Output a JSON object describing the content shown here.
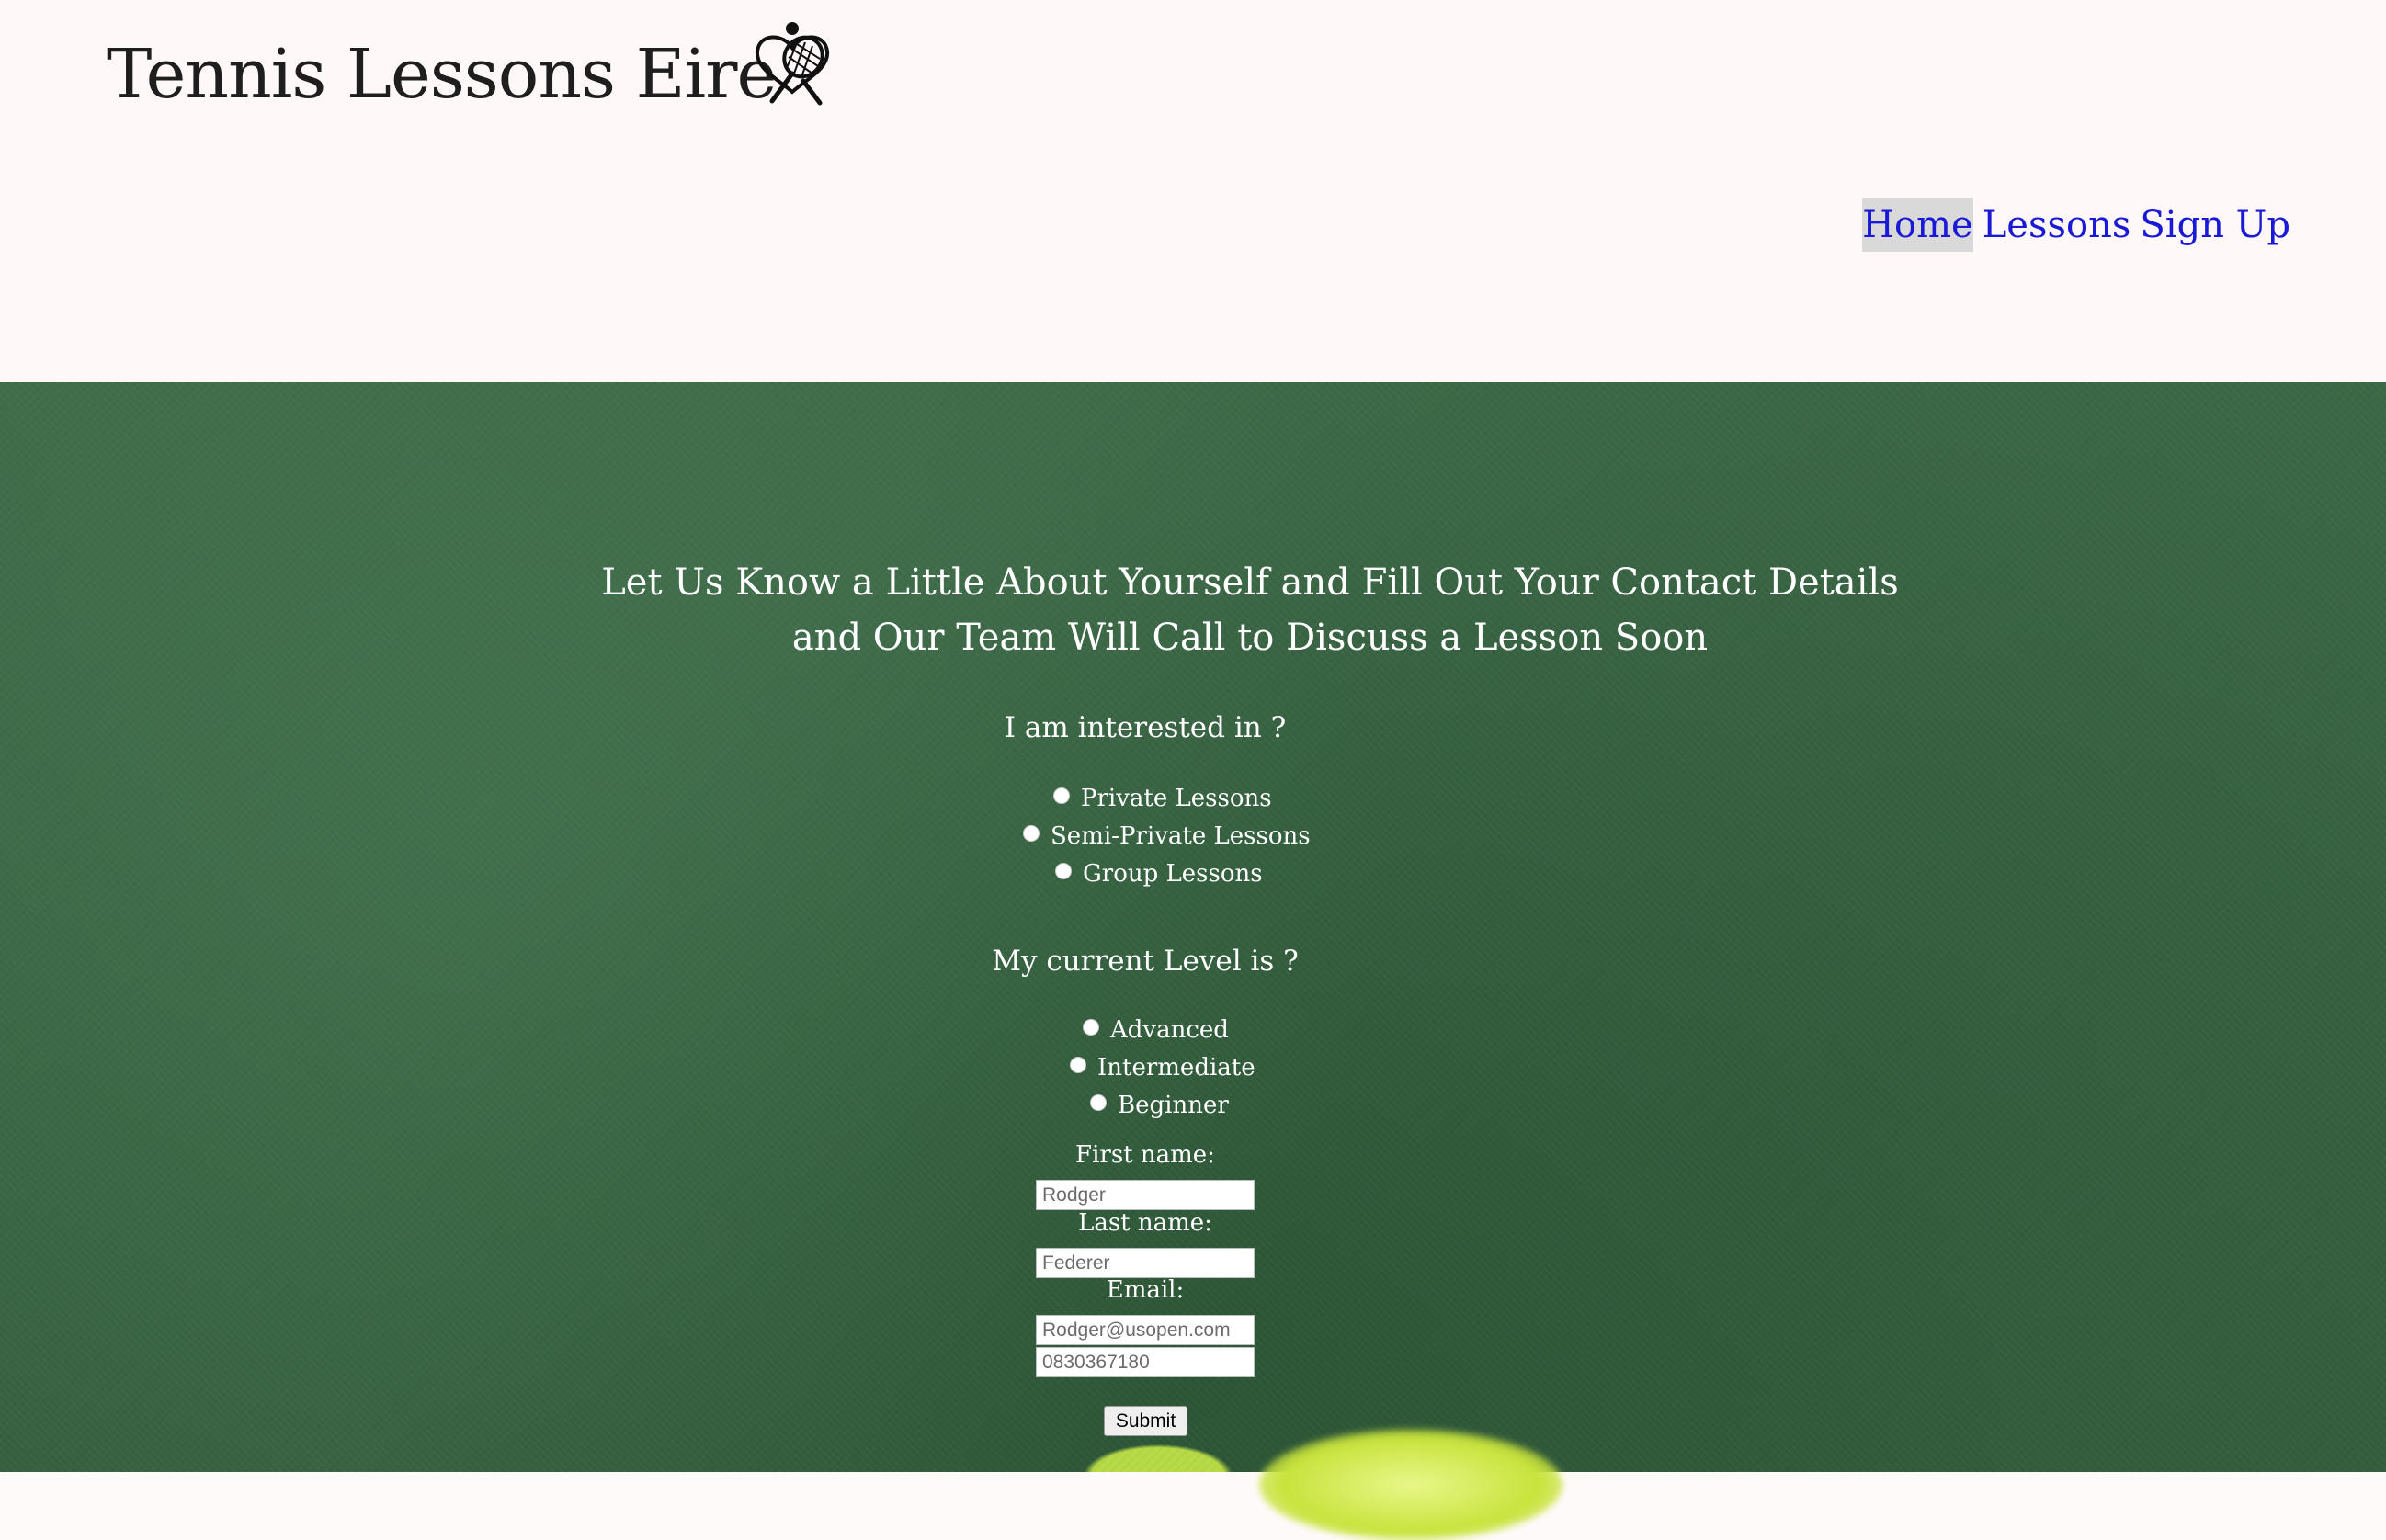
{
  "header": {
    "logo_text": "Tennis Lessons Eire",
    "logo_icon": "tennis-racket-heart-icon"
  },
  "nav": {
    "items": [
      {
        "label": "Home",
        "active": true
      },
      {
        "label": "Lessons",
        "active": false
      },
      {
        "label": "Sign Up",
        "active": false
      }
    ]
  },
  "form": {
    "headline": "Let Us Know a Little About Yourself and Fill Out Your Contact Details and Our Team Will Call to Discuss a Lesson Soon",
    "interest_question": "I am interested in ?",
    "interest_options": [
      "Private Lessons",
      "Semi-Private Lessons",
      "Group Lessons"
    ],
    "level_question": "My current Level is ?",
    "level_options": [
      "Advanced",
      "Intermediate",
      "Beginner"
    ],
    "first_name_label": "First name:",
    "first_name_placeholder": "Rodger",
    "last_name_label": "Last name:",
    "last_name_placeholder": "Federer",
    "email_label": "Email:",
    "email_placeholder": "Rodger@usopen.com",
    "phone_placeholder": "0830367180",
    "submit_label": "Submit"
  },
  "colors": {
    "header_bg": "#fff8f8",
    "nav_link": "#1a19d6",
    "hero_green": "#3a6645",
    "text_on_hero": "#ffffff"
  }
}
